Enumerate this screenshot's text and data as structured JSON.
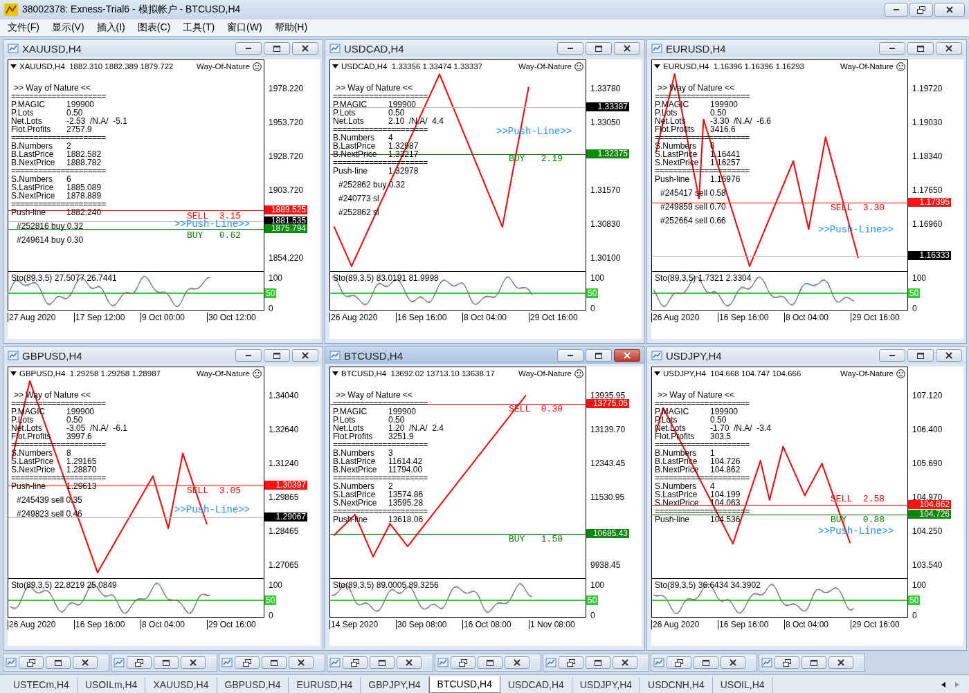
{
  "window": {
    "title": "38002378: Exness-Trial6 - 模拟帐户 - BTCUSD,H4"
  },
  "menu": [
    "文件(F)",
    "显示(V)",
    "插入(I)",
    "图表(C)",
    "工具(T)",
    "窗口(W)",
    "帮助(H)"
  ],
  "charts": [
    {
      "title": "XAUUSD,H4",
      "active": false,
      "header": "XAUUSD,H4  1882.310 1882.389 1879.722",
      "indicator": "Way-Of-Nature",
      "info": [
        {
          "kind": "heading",
          "text": ">> Way of Nature <<"
        },
        {
          "kind": "rule",
          "text": "====================="
        },
        {
          "kind": "row",
          "label": "P.MAGIC",
          "value": "199900"
        },
        {
          "kind": "row",
          "label": "P.Lots",
          "value": "0.50"
        },
        {
          "kind": "row",
          "label": "Net.Lots",
          "value": "-2.53  /N.A/  -5.1"
        },
        {
          "kind": "row",
          "label": "Flot.Profits",
          "value": "2757.9"
        },
        {
          "kind": "rule",
          "text": "====================="
        },
        {
          "kind": "row",
          "label": "B.Numbers",
          "value": "2"
        },
        {
          "kind": "row",
          "label": "B.LastPrice",
          "value": "1882.582"
        },
        {
          "kind": "row",
          "label": "B.NextPrice",
          "value": "1888.782"
        },
        {
          "kind": "rule",
          "text": "====================="
        },
        {
          "kind": "row",
          "label": "S.Numbers",
          "value": "6"
        },
        {
          "kind": "row",
          "label": "S.LastPrice",
          "value": "1885.089"
        },
        {
          "kind": "row",
          "label": "S.NextPrice",
          "value": "1878.889"
        },
        {
          "kind": "rule",
          "text": "====================="
        },
        {
          "kind": "row",
          "label": "Push-line",
          "value": "1882.240"
        }
      ],
      "orders": [
        "#252816 buy 0.32",
        "#249614 buy 0.30"
      ],
      "labels": [
        {
          "kind": "sell",
          "text": "SELL  3.15"
        },
        {
          "kind": "push",
          "text": ">>Push-Line>>"
        },
        {
          "kind": "buy",
          "text": "BUY   0.62"
        }
      ],
      "price_ticks": [
        "1978.220",
        "1953.720",
        "1928.720",
        "1903.720",
        "1854.220"
      ],
      "price_tags": [
        {
          "kind": "sell",
          "text": "1889.525"
        },
        {
          "kind": "bid",
          "text": "1881.535"
        },
        {
          "kind": "buy",
          "text": "1875.794"
        }
      ],
      "oscillator": {
        "label": "Sto(89,3,5) 27.5077 26.7441",
        "ticks": [
          "100",
          "50",
          "0"
        ]
      },
      "dates": [
        "27 Aug 2020",
        "17 Sep 12:00",
        "9 Oct 00:00",
        "30 Oct 12:00"
      ]
    },
    {
      "title": "USDCAD,H4",
      "active": false,
      "header": "USDCAD,H4  1.33356 1.33474 1.33337",
      "indicator": "Way-Of-Nature",
      "info": [
        {
          "kind": "heading",
          "text": ">> Way of Nature <<"
        },
        {
          "kind": "rule",
          "text": "====================="
        },
        {
          "kind": "row",
          "label": "P.MAGIC",
          "value": "199900"
        },
        {
          "kind": "row",
          "label": "P.Lots",
          "value": "0.50"
        },
        {
          "kind": "row",
          "label": "Net.Lots",
          "value": "2.10  /N.A/  4.4"
        },
        {
          "kind": "rule",
          "text": "====================="
        },
        {
          "kind": "row",
          "label": "B.Numbers",
          "value": "4"
        },
        {
          "kind": "row",
          "label": "B.LastPrice",
          "value": "1.32987"
        },
        {
          "kind": "row",
          "label": "B.NextPrice",
          "value": "1.33217"
        },
        {
          "kind": "rule",
          "text": "====================="
        },
        {
          "kind": "row",
          "label": "Push-line",
          "value": "1.32978"
        }
      ],
      "orders": [
        "#252862 buy 0.32",
        "#240773 sl",
        "#252862 sl"
      ],
      "labels": [
        {
          "kind": "push",
          "text": ">>Push-Line>>"
        },
        {
          "kind": "buy",
          "text": "BUY   2.19"
        }
      ],
      "price_ticks": [
        "1.33780",
        "1.33050",
        "1.31570",
        "1.30830",
        "1.30100"
      ],
      "price_tags": [
        {
          "kind": "bid",
          "text": "1.33387"
        },
        {
          "kind": "buy",
          "text": "1.32375"
        }
      ],
      "oscillator": {
        "label": "Sto(89,3,5) 83.0191 81.9998",
        "ticks": [
          "100",
          "50",
          "0"
        ]
      },
      "dates": [
        "26 Aug 2020",
        "16 Sep 16:00",
        "8 Oct 04:00",
        "29 Oct 16:00"
      ]
    },
    {
      "title": "EURUSD,H4",
      "active": false,
      "header": "EURUSD,H4  1.16396 1.16396 1.16293",
      "indicator": "Way-Of-Nature",
      "info": [
        {
          "kind": "heading",
          "text": ">> Way of Nature <<"
        },
        {
          "kind": "rule",
          "text": "====================="
        },
        {
          "kind": "row",
          "label": "P.MAGIC",
          "value": "199900"
        },
        {
          "kind": "row",
          "label": "P.Lots",
          "value": "0.50"
        },
        {
          "kind": "row",
          "label": "Net.Lots",
          "value": "-3.30  /N.A/  -6.6"
        },
        {
          "kind": "row",
          "label": "Flot.Profits",
          "value": "3416.6"
        },
        {
          "kind": "rule",
          "text": "====================="
        },
        {
          "kind": "row",
          "label": "S.Numbers",
          "value": "6"
        },
        {
          "kind": "row",
          "label": "S.LastPrice",
          "value": "1.16441"
        },
        {
          "kind": "row",
          "label": "S.NextPrice",
          "value": "1.16257"
        },
        {
          "kind": "rule",
          "text": "====================="
        },
        {
          "kind": "row",
          "label": "Push-line",
          "value": "1.16976"
        }
      ],
      "orders": [
        "#245417 sell 0.58",
        "#249859 sell 0.70",
        "#252664 sell 0.66"
      ],
      "labels": [
        {
          "kind": "sell",
          "text": "SELL  3.30"
        },
        {
          "kind": "push",
          "text": ">>Push-Line>>"
        }
      ],
      "price_ticks": [
        "1.19720",
        "1.19030",
        "1.18340",
        "1.17650",
        "1.16960"
      ],
      "price_tags": [
        {
          "kind": "sell",
          "text": "1.17395"
        },
        {
          "kind": "bid",
          "text": "1.16333"
        }
      ],
      "oscillator": {
        "label": "Sto(89,3,5) 1.7321 2.3304",
        "ticks": [
          "100",
          "50",
          "0"
        ]
      },
      "dates": [
        "26 Aug 2020",
        "16 Sep 16:00",
        "8 Oct 04:00",
        "29 Oct 16:00"
      ]
    },
    {
      "title": "GBPUSD,H4",
      "active": false,
      "header": "GBPUSD,H4  1.29258 1.29258 1.28987",
      "indicator": "Way-Of-Nature",
      "info": [
        {
          "kind": "heading",
          "text": ">> Way of Nature <<"
        },
        {
          "kind": "rule",
          "text": "====================="
        },
        {
          "kind": "row",
          "label": "P.MAGIC",
          "value": "199900"
        },
        {
          "kind": "row",
          "label": "P.Lots",
          "value": "0.50"
        },
        {
          "kind": "row",
          "label": "Net.Lots",
          "value": "-3.05  /N.A/  -6.1"
        },
        {
          "kind": "row",
          "label": "Flot.Profits",
          "value": "3997.6"
        },
        {
          "kind": "rule",
          "text": "====================="
        },
        {
          "kind": "row",
          "label": "S.Numbers",
          "value": "8"
        },
        {
          "kind": "row",
          "label": "S.LastPrice",
          "value": "1.29165"
        },
        {
          "kind": "row",
          "label": "S.NextPrice",
          "value": "1.28870"
        },
        {
          "kind": "rule",
          "text": "====================="
        },
        {
          "kind": "row",
          "label": "Push-line",
          "value": "1.29613"
        }
      ],
      "orders": [
        "#245439 sell 0.35",
        "#249823 sell 0.46"
      ],
      "labels": [
        {
          "kind": "sell",
          "text": "SELL  3.05"
        },
        {
          "kind": "push",
          "text": ">>Push-Line>>"
        }
      ],
      "price_ticks": [
        "1.34040",
        "1.32640",
        "1.31240",
        "1.29865",
        "1.28465",
        "1.27065"
      ],
      "price_tags": [
        {
          "kind": "sell",
          "text": "1.30397"
        },
        {
          "kind": "bid",
          "text": "1.29067"
        }
      ],
      "oscillator": {
        "label": "Sto(89,3,5) 22.8219 25.0849",
        "ticks": [
          "100",
          "50",
          "0"
        ]
      },
      "dates": [
        "26 Aug 2020",
        "16 Sep 16:00",
        "8 Oct 04:00",
        "29 Oct 16:00"
      ]
    },
    {
      "title": "BTCUSD,H4",
      "active": true,
      "header": "BTCUSD,H4  13692.02 13713.10 13638.17",
      "indicator": "Way-Of-Nature",
      "info": [
        {
          "kind": "heading",
          "text": ">> Way of Nature <<"
        },
        {
          "kind": "rule",
          "text": "====================="
        },
        {
          "kind": "row",
          "label": "P.MAGIC",
          "value": "199900"
        },
        {
          "kind": "row",
          "label": "P.Lots",
          "value": "0.50"
        },
        {
          "kind": "row",
          "label": "Net.Lots",
          "value": "1.20  /N.A/  2.4"
        },
        {
          "kind": "row",
          "label": "Flot.Profits",
          "value": "3251.9"
        },
        {
          "kind": "rule",
          "text": "====================="
        },
        {
          "kind": "row",
          "label": "B.Numbers",
          "value": "3"
        },
        {
          "kind": "row",
          "label": "B.LastPrice",
          "value": "11614.42"
        },
        {
          "kind": "row",
          "label": "B.NextPrice",
          "value": "11794.00"
        },
        {
          "kind": "rule",
          "text": "====================="
        },
        {
          "kind": "row",
          "label": "S.Numbers",
          "value": "2"
        },
        {
          "kind": "row",
          "label": "S.LastPrice",
          "value": "13574.86"
        },
        {
          "kind": "row",
          "label": "S.NextPrice",
          "value": "13595.28"
        },
        {
          "kind": "rule",
          "text": "====================="
        },
        {
          "kind": "row",
          "label": "Push-line",
          "value": "13618.06"
        }
      ],
      "labels": [
        {
          "kind": "sell",
          "text": "SELL  0.30"
        },
        {
          "kind": "buy",
          "text": "BUY   1.50"
        }
      ],
      "price_ticks": [
        "13935.95",
        "13139.70",
        "12343.45",
        "11530.95",
        "9938.45"
      ],
      "price_tags": [
        {
          "kind": "sell",
          "text": "13775.05"
        },
        {
          "kind": "buy",
          "text": "10685.43"
        }
      ],
      "oscillator": {
        "label": "Sto(89,3,5) 89.0005 89.3256",
        "ticks": [
          "100",
          "50",
          "0"
        ]
      },
      "dates": [
        "14 Sep 2020",
        "30 Sep 08:00",
        "16 Oct 08:00",
        "1 Nov 08:00"
      ]
    },
    {
      "title": "USDJPY,H4",
      "active": false,
      "header": "USDJPY,H4  104.668 104.747 104.666",
      "indicator": "Way-Of-Nature",
      "info": [
        {
          "kind": "heading",
          "text": ">> Way of Nature <<"
        },
        {
          "kind": "rule",
          "text": "====================="
        },
        {
          "kind": "row",
          "label": "P.MAGIC",
          "value": "199900"
        },
        {
          "kind": "row",
          "label": "P.Lots",
          "value": "0.50"
        },
        {
          "kind": "row",
          "label": "Net.Lots",
          "value": "-1.70  /N.A/  -3.4"
        },
        {
          "kind": "row",
          "label": "Flot.Profits",
          "value": "303.5"
        },
        {
          "kind": "rule",
          "text": "====================="
        },
        {
          "kind": "row",
          "label": "B.Numbers",
          "value": "1"
        },
        {
          "kind": "row",
          "label": "B.LastPrice",
          "value": "104.726"
        },
        {
          "kind": "row",
          "label": "B.NextPrice",
          "value": "104.862"
        },
        {
          "kind": "rule",
          "text": "====================="
        },
        {
          "kind": "row",
          "label": "S.Numbers",
          "value": "4"
        },
        {
          "kind": "row",
          "label": "S.LastPrice",
          "value": "104.199"
        },
        {
          "kind": "row",
          "label": "S.NextPrice",
          "value": "104.063"
        },
        {
          "kind": "rule",
          "text": "====================="
        },
        {
          "kind": "row",
          "label": "Push-line",
          "value": "104.536"
        }
      ],
      "labels": [
        {
          "kind": "sell",
          "text": "SELL  2.58"
        },
        {
          "kind": "buy",
          "text": "BUY   0.88"
        },
        {
          "kind": "push",
          "text": ">>Push-Line>>"
        }
      ],
      "price_ticks": [
        "107.120",
        "106.400",
        "105.690",
        "104.970",
        "104.250",
        "103.540"
      ],
      "price_tags": [
        {
          "kind": "sell",
          "text": "104.862"
        },
        {
          "kind": "buy",
          "text": "104.726"
        }
      ],
      "oscillator": {
        "label": "Sto(89,3,5) 36.6434 34.3902",
        "ticks": [
          "100",
          "50",
          "0"
        ]
      },
      "dates": [
        "26 Aug 2020",
        "16 Sep 16:00",
        "8 Oct 04:00",
        "29 Oct 16:00"
      ]
    }
  ],
  "minimized": [
    {
      "kind": "window"
    },
    {
      "kind": "window"
    },
    {
      "kind": "window"
    },
    {
      "kind": "window"
    },
    {
      "kind": "window"
    },
    {
      "kind": "window"
    },
    {
      "kind": "window"
    },
    {
      "kind": "window"
    }
  ],
  "tabs": [
    {
      "label": "USTECm,H4",
      "selected": false
    },
    {
      "label": "USOILm,H4",
      "selected": false
    },
    {
      "label": "XAUUSD,H4",
      "selected": false
    },
    {
      "label": "GBPUSD,H4",
      "selected": false
    },
    {
      "label": "EURUSD,H4",
      "selected": false
    },
    {
      "label": "GBPJPY,H4",
      "selected": false
    },
    {
      "label": "BTCUSD,H4",
      "selected": true
    },
    {
      "label": "USDCAD,H4",
      "selected": false
    },
    {
      "label": "USDJPY,H4",
      "selected": false
    },
    {
      "label": "USDCNH,H4",
      "selected": false
    },
    {
      "label": "USOIL,H4",
      "selected": false
    }
  ]
}
